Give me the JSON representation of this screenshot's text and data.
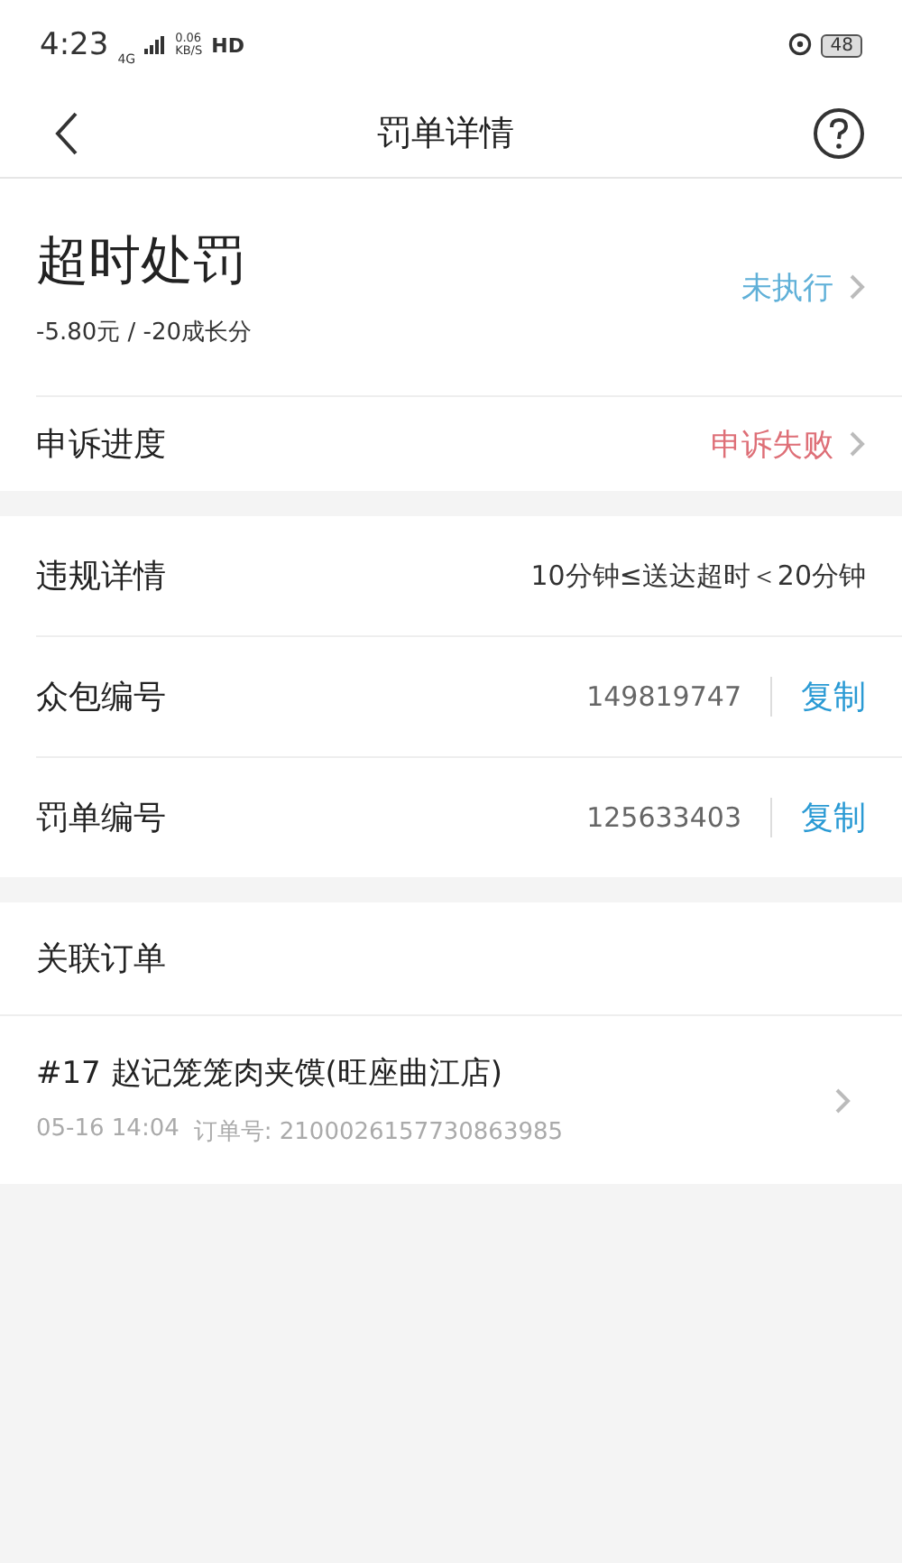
{
  "status_bar": {
    "time": "4:23",
    "network": "4G",
    "speed_value": "0.06",
    "speed_unit": "KB/S",
    "hd": "HD",
    "battery": "48"
  },
  "header": {
    "title": "罚单详情"
  },
  "penalty": {
    "title": "超时处罚",
    "detail": "-5.80元 / -20成长分",
    "status": {
      "text": "未执行",
      "kind": "pending"
    }
  },
  "appeal": {
    "label": "申诉进度",
    "status": {
      "text": "申诉失败",
      "kind": "failed"
    }
  },
  "details": [
    {
      "kind": "text",
      "label": "违规详情",
      "value": "10分钟≤送达超时＜20分钟"
    },
    {
      "kind": "copy",
      "label": "众包编号",
      "value": "149819747",
      "action": "复制"
    },
    {
      "kind": "copy",
      "label": "罚单编号",
      "value": "125633403",
      "action": "复制"
    }
  ],
  "related": {
    "heading": "关联订单",
    "order": {
      "title": "#17 赵记笼笼肉夹馍(旺座曲江店)",
      "time": "05-16 14:04",
      "number": "订单号: 2100026157730863985"
    }
  }
}
